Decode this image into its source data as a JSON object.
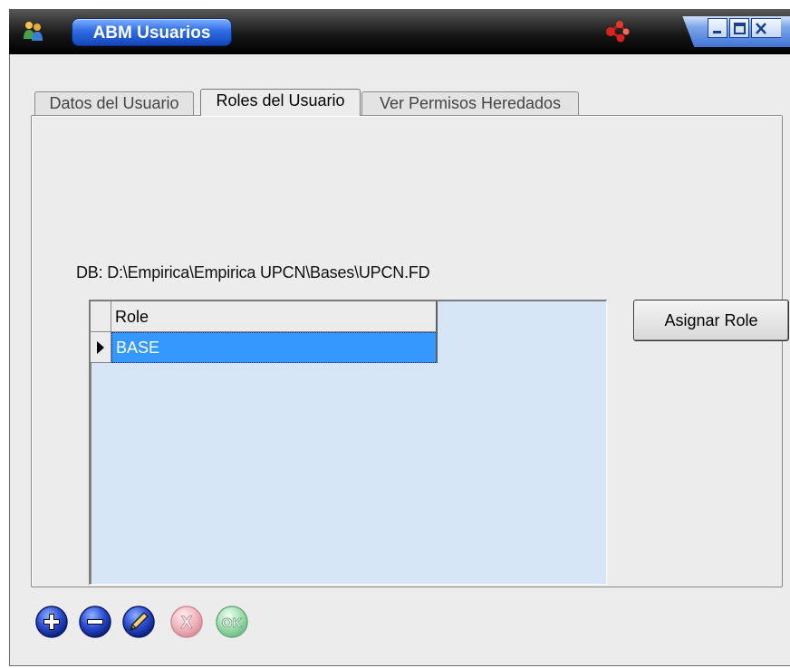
{
  "window": {
    "title": "ABM Usuarios",
    "app_icon": "users-icon",
    "logo_icon": "red-molecule-logo-icon",
    "controls": [
      "minimize-icon",
      "maximize-icon",
      "close-icon"
    ]
  },
  "tabs": [
    {
      "label": "Datos del Usuario",
      "active": false
    },
    {
      "label": "Roles del Usuario",
      "active": true
    },
    {
      "label": "Ver Permisos Heredados",
      "active": false
    }
  ],
  "db": {
    "text": "DB:  D:\\Empirica\\Empirica UPCN\\Bases\\UPCN.FD"
  },
  "grid": {
    "columns": [
      "Role"
    ],
    "rows": [
      {
        "role": "BASE",
        "selected": true
      }
    ]
  },
  "assign_button": "Asignar Role",
  "toolbar": [
    {
      "name": "add",
      "icon": "plus-icon",
      "enabled": true
    },
    {
      "name": "remove",
      "icon": "minus-icon",
      "enabled": true
    },
    {
      "name": "edit",
      "icon": "pencil-icon",
      "enabled": true
    },
    {
      "name": "cancel",
      "icon": "x-icon",
      "label": "X",
      "enabled": false
    },
    {
      "name": "ok",
      "icon": "ok-icon",
      "label": "OK",
      "enabled": false
    }
  ],
  "colors": {
    "selection": "#3399ff",
    "grid_background": "#d6e6f6",
    "title_pill": "#2f6de6"
  }
}
